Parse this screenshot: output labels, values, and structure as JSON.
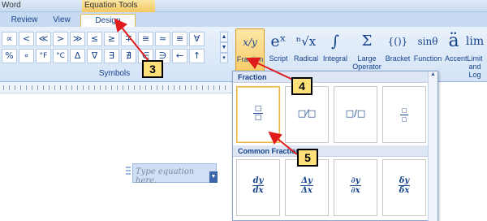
{
  "title": {
    "app": "Word",
    "context_tools": "Equation Tools"
  },
  "tabs": [
    "Review",
    "View",
    "Design"
  ],
  "symbols": {
    "row1": [
      "∝",
      "<",
      "≪",
      ">",
      "≫",
      "≤",
      "≥",
      "∓",
      "≅",
      "≈",
      "≡",
      "∀"
    ],
    "row2": [
      "%",
      "∘",
      "°F",
      "°C",
      "Δ",
      "∇",
      "∃",
      "∄",
      "∈",
      "∋",
      "←",
      "↑"
    ],
    "group_label": "Symbols"
  },
  "structures": [
    {
      "glyph": "x/y",
      "label": "Fraction"
    },
    {
      "glyph": "eˣ",
      "label": "Script"
    },
    {
      "glyph": "ⁿ√x",
      "label": "Radical"
    },
    {
      "glyph": "∫",
      "label": "Integral"
    },
    {
      "glyph": "Σ",
      "label": "Large Operator"
    },
    {
      "glyph": "{()}",
      "label": "Bracket"
    },
    {
      "glyph": "sinθ",
      "label": "Function"
    },
    {
      "glyph": "ä",
      "label": "Accent"
    },
    {
      "glyph": "lim",
      "label": "Limit and Log"
    }
  ],
  "gallery": {
    "section1": "Fraction",
    "section2": "Common Fraction",
    "common": [
      {
        "num": "dy",
        "den": "dx"
      },
      {
        "num": "Δy",
        "den": "Δx"
      },
      {
        "num": "∂y",
        "den": "∂x"
      },
      {
        "num": "δy",
        "den": "δx"
      }
    ]
  },
  "equation_placeholder": "Type equation here.",
  "callouts": [
    "3",
    "4",
    "5"
  ]
}
